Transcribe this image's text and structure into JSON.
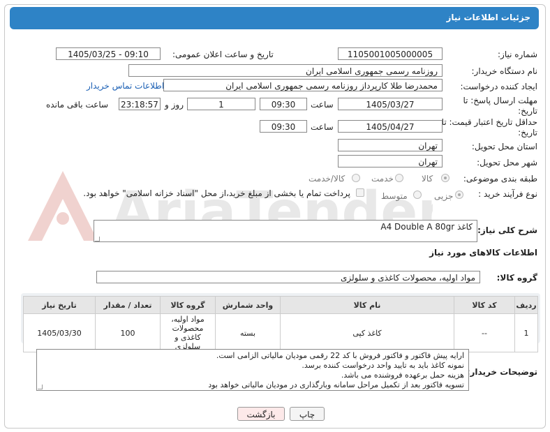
{
  "header": {
    "title": "جزئیات اطلاعات نیاز"
  },
  "fields": {
    "need_number": {
      "label": "شماره نیاز:",
      "value": "1105001005000005"
    },
    "announce": {
      "label": "تاریخ و ساعت اعلان عمومی:",
      "value": "1405/03/25 - 09:10"
    },
    "buyer_org": {
      "label": "نام دستگاه خریدار:",
      "value": "روزنامه رسمی جمهوری اسلامی ایران"
    },
    "creator": {
      "label": "ایجاد کننده درخواست:",
      "value": "محمدرضا طلا کارپرداز روزنامه رسمی جمهوری اسلامی ایران",
      "link": "اطلاعات تماس خریدار"
    },
    "deadline": {
      "label": "مهلت ارسال پاسخ: تا تاریخ:",
      "date": "1405/03/27",
      "time_label": "ساعت",
      "time": "09:30",
      "days": "1",
      "days_label": "روز و",
      "remaining": "23:18:57",
      "remaining_label": "ساعت باقی مانده"
    },
    "price_validity": {
      "label": "حداقل تاریخ اعتبار قیمت: تا تاریخ:",
      "date": "1405/04/27",
      "time_label": "ساعت",
      "time": "09:30"
    },
    "province": {
      "label": "استان محل تحویل:",
      "value": "تهران"
    },
    "city": {
      "label": "شهر محل تحویل:",
      "value": "تهران"
    },
    "category": {
      "label": "طبقه بندی موضوعی:",
      "options": [
        "کالا",
        "خدمت",
        "کالا/خدمت"
      ]
    },
    "process": {
      "label": "نوع فرآیند خرید :",
      "options": [
        "جزیی",
        "متوسط"
      ],
      "note": "پرداخت تمام یا بخشی از مبلغ خرید،از محل \"اسناد خزانه اسلامی\" خواهد بود."
    }
  },
  "description": {
    "label": "شرح کلی نیاز:",
    "value": "کاغذ A4 Double A 80gr"
  },
  "goods_section": {
    "title": "اطلاعات کالاهای مورد نیاز"
  },
  "goods_group": {
    "label": "گروه کالا:",
    "value": "مواد اولیه، محصولات کاغذی و سلولزی"
  },
  "table": {
    "headers": [
      "ردیف",
      "کد کالا",
      "نام کالا",
      "واحد شمارش",
      "گروه کالا",
      "تعداد / مقدار",
      "تاریخ نیاز"
    ],
    "rows": [
      [
        "1",
        "--",
        "کاغذ کپی",
        "بسته",
        "مواد اولیه، محصولات کاغذی و سلولزی",
        "100",
        "1405/03/30"
      ]
    ]
  },
  "notes": {
    "label": "توضیحات خریدار:",
    "lines": [
      "ارایه پیش فاکتور و فاکتور فروش با کد 22 رقمی مودیان مالیاتی الزامی است.",
      "نمونه کاغذ باید به تایید واحد درخواست کننده برسد.",
      "هزینه حمل برعهده فروشنده می باشد.",
      "تسویه فاکتور بعد از تکمیل مراحل سامانه وبارگذاری در مودیان مالیاتی خواهد بود"
    ]
  },
  "buttons": {
    "print": "چاپ",
    "back": "بازگشت"
  },
  "watermark": {
    "text": "AriaTender.net"
  },
  "colors": {
    "header": "#2e83c6",
    "link": "#1a5fb4",
    "back_button": "#fde9e9"
  }
}
